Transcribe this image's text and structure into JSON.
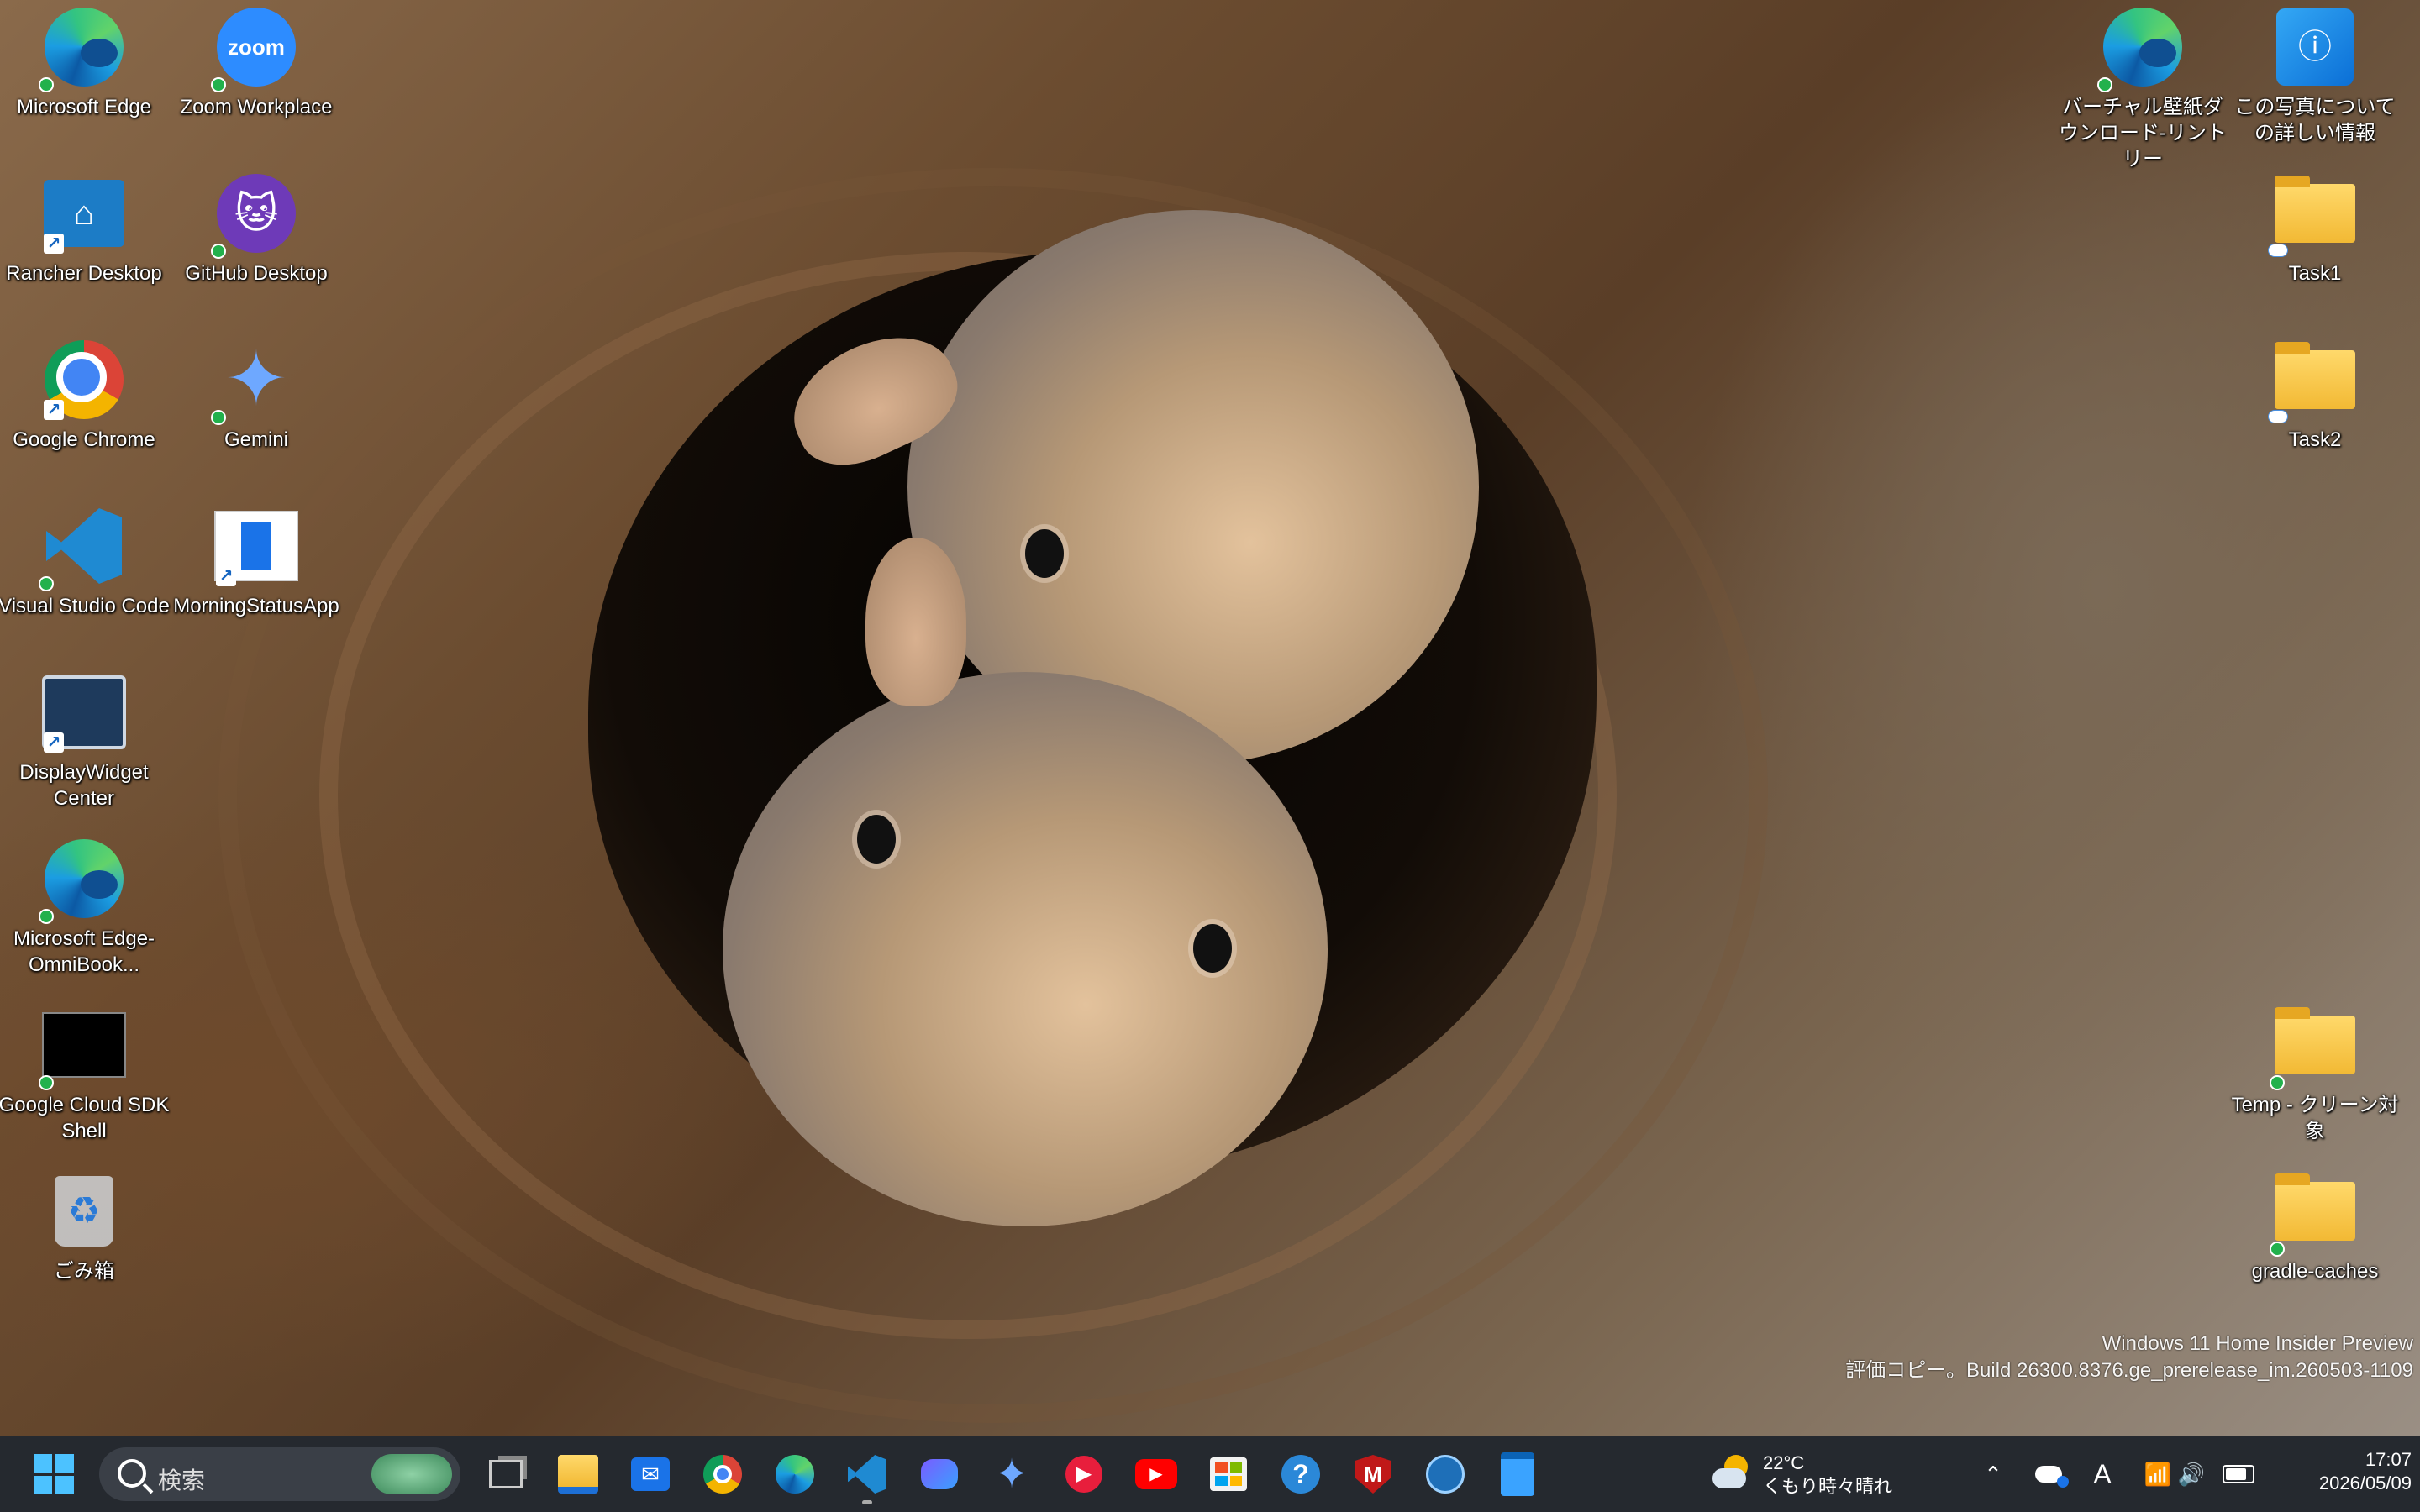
{
  "desktop": {
    "left_icons": [
      {
        "label": "Microsoft Edge",
        "icon": "edge-icon"
      },
      {
        "label": "Zoom Workplace",
        "icon": "zoom-icon"
      },
      {
        "label": "Rancher Desktop",
        "icon": "rancher-icon"
      },
      {
        "label": "GitHub Desktop",
        "icon": "github-icon"
      },
      {
        "label": "Google Chrome",
        "icon": "chrome-icon"
      },
      {
        "label": "Gemini",
        "icon": "gemini-icon"
      },
      {
        "label": "Visual Studio Code",
        "icon": "vscode-icon"
      },
      {
        "label": "MorningStatusApp",
        "icon": "morning-status-icon"
      },
      {
        "label": "DisplayWidget Center",
        "icon": "display-widget-icon"
      },
      {
        "label": "Microsoft Edge-OmniBook...",
        "icon": "edge-icon"
      },
      {
        "label": "Google Cloud SDK Shell",
        "icon": "terminal-icon"
      },
      {
        "label": "ごみ箱",
        "icon": "recycle-bin-icon"
      }
    ],
    "right_icons": [
      {
        "label": "バーチャル壁紙ダウンロード-リントリー",
        "icon": "edge-icon"
      },
      {
        "label": "この写真についての詳しい情報",
        "icon": "photo-info-icon"
      },
      {
        "label": "Task1",
        "icon": "folder-icon"
      },
      {
        "label": "Task2",
        "icon": "folder-icon"
      },
      {
        "label": "Temp - クリーン対象",
        "icon": "folder-icon"
      },
      {
        "label": "gradle-caches",
        "icon": "folder-icon"
      }
    ],
    "watermark": {
      "line1": "Windows 11 Home Insider Preview",
      "line2": "評価コピー。Build 26300.8376.ge_prerelease_im.260503-1109"
    }
  },
  "taskbar": {
    "search_placeholder": "検索",
    "apps": [
      "start",
      "task-view",
      "file-explorer",
      "outlook",
      "chrome",
      "edge",
      "vscode",
      "copilot",
      "gemini",
      "music",
      "youtube",
      "store",
      "help",
      "mcafee",
      "network",
      "notepad"
    ],
    "weather": {
      "temp": "22°C",
      "condition": "くもり時々晴れ"
    },
    "tray": {
      "ime": "A"
    },
    "clock": {
      "time": "17:07",
      "date": "2026/05/09"
    }
  },
  "colors": {
    "taskbar_bg": "#1c2026",
    "accent": "#4cc2ff"
  }
}
